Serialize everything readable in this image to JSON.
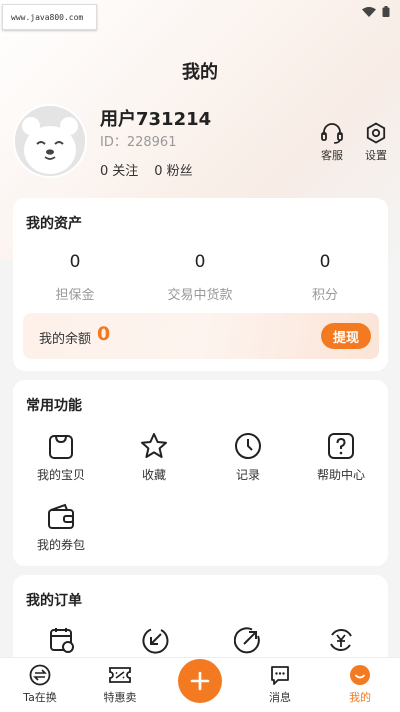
{
  "watermark": "www.java800.com",
  "page": {
    "title": "我的"
  },
  "user": {
    "name": "用户731214",
    "id_text": "ID：228961",
    "following_count": "0",
    "following_label": "关注",
    "fans_count": "0",
    "fans_label": "粉丝"
  },
  "top_actions": {
    "service": "客服",
    "settings": "设置"
  },
  "assets": {
    "title": "我的资产",
    "items": [
      {
        "value": "0",
        "label": "担保金"
      },
      {
        "value": "0",
        "label": "交易中货款"
      },
      {
        "value": "0",
        "label": "积分"
      }
    ],
    "balance_label": "我的余额",
    "balance_value": "0",
    "withdraw_label": "提现"
  },
  "functions": {
    "title": "常用功能",
    "items": [
      {
        "label": "我的宝贝",
        "icon": "bag-icon"
      },
      {
        "label": "收藏",
        "icon": "star-icon"
      },
      {
        "label": "记录",
        "icon": "clock-icon"
      },
      {
        "label": "帮助中心",
        "icon": "help-icon"
      },
      {
        "label": "我的券包",
        "icon": "wallet-icon"
      }
    ]
  },
  "orders": {
    "title": "我的订单",
    "icons": [
      "calendar-settings-icon",
      "arrow-in-icon",
      "arrow-out-icon",
      "refund-icon"
    ]
  },
  "tabbar": {
    "items": [
      {
        "label": "Ta在换",
        "icon": "exchange-icon"
      },
      {
        "label": "特惠卖",
        "icon": "ticket-icon"
      },
      {
        "label": "消息",
        "icon": "message-icon"
      },
      {
        "label": "我的",
        "icon": "mine-icon"
      }
    ],
    "active": "我的"
  },
  "colors": {
    "accent": "#f47a22",
    "muted": "#999999",
    "background": "#f4f4f4"
  }
}
